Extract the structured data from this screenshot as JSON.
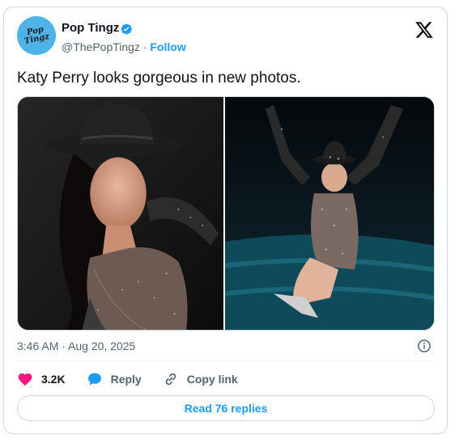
{
  "author": {
    "display_name": "Pop Tingz",
    "handle": "@ThePopTingz",
    "separator": "·",
    "follow_label": "Follow",
    "avatar_text": "Pop Tingz",
    "verified": true
  },
  "tweet": {
    "text": "Katy Perry looks gorgeous in new photos.",
    "timestamp": "3:46 AM · Aug 20, 2025"
  },
  "media": [
    {
      "icon": "photo",
      "alt": ""
    },
    {
      "icon": "photo",
      "alt": ""
    }
  ],
  "actions": {
    "likes_count": "3.2K",
    "reply_label": "Reply",
    "copy_link_label": "Copy link"
  },
  "read_replies_label": "Read 76 replies",
  "colors": {
    "accent": "#1d9bf0",
    "like": "#f91880",
    "text": "#0f1419",
    "muted": "#536471",
    "border": "#cfd9de"
  }
}
